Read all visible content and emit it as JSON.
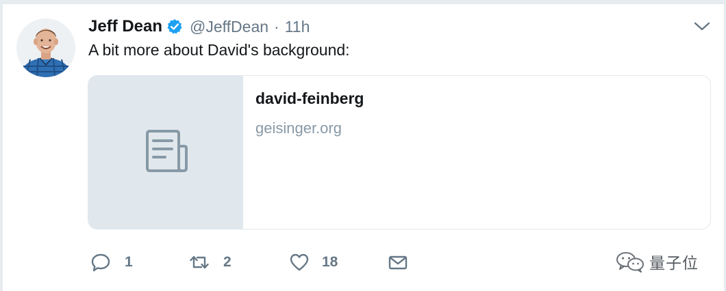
{
  "tweet": {
    "author_name": "Jeff Dean",
    "handle": "@JeffDean",
    "separator": "·",
    "timestamp": "11h",
    "verified": true,
    "text": "A bit more about David's background:"
  },
  "card": {
    "title": "david-feinberg",
    "domain": "geisinger.org",
    "thumbnail_icon": "document-icon"
  },
  "actions": {
    "reply_count": "1",
    "retweet_count": "2",
    "like_count": "18"
  },
  "watermark": {
    "text": "量子位",
    "logo_icon": "wechat-icon"
  },
  "colors": {
    "verified_blue": "#1da1f2",
    "secondary_text": "#657786",
    "card_thumb_bg": "#e1e8ed",
    "border": "#e1e8ed"
  }
}
